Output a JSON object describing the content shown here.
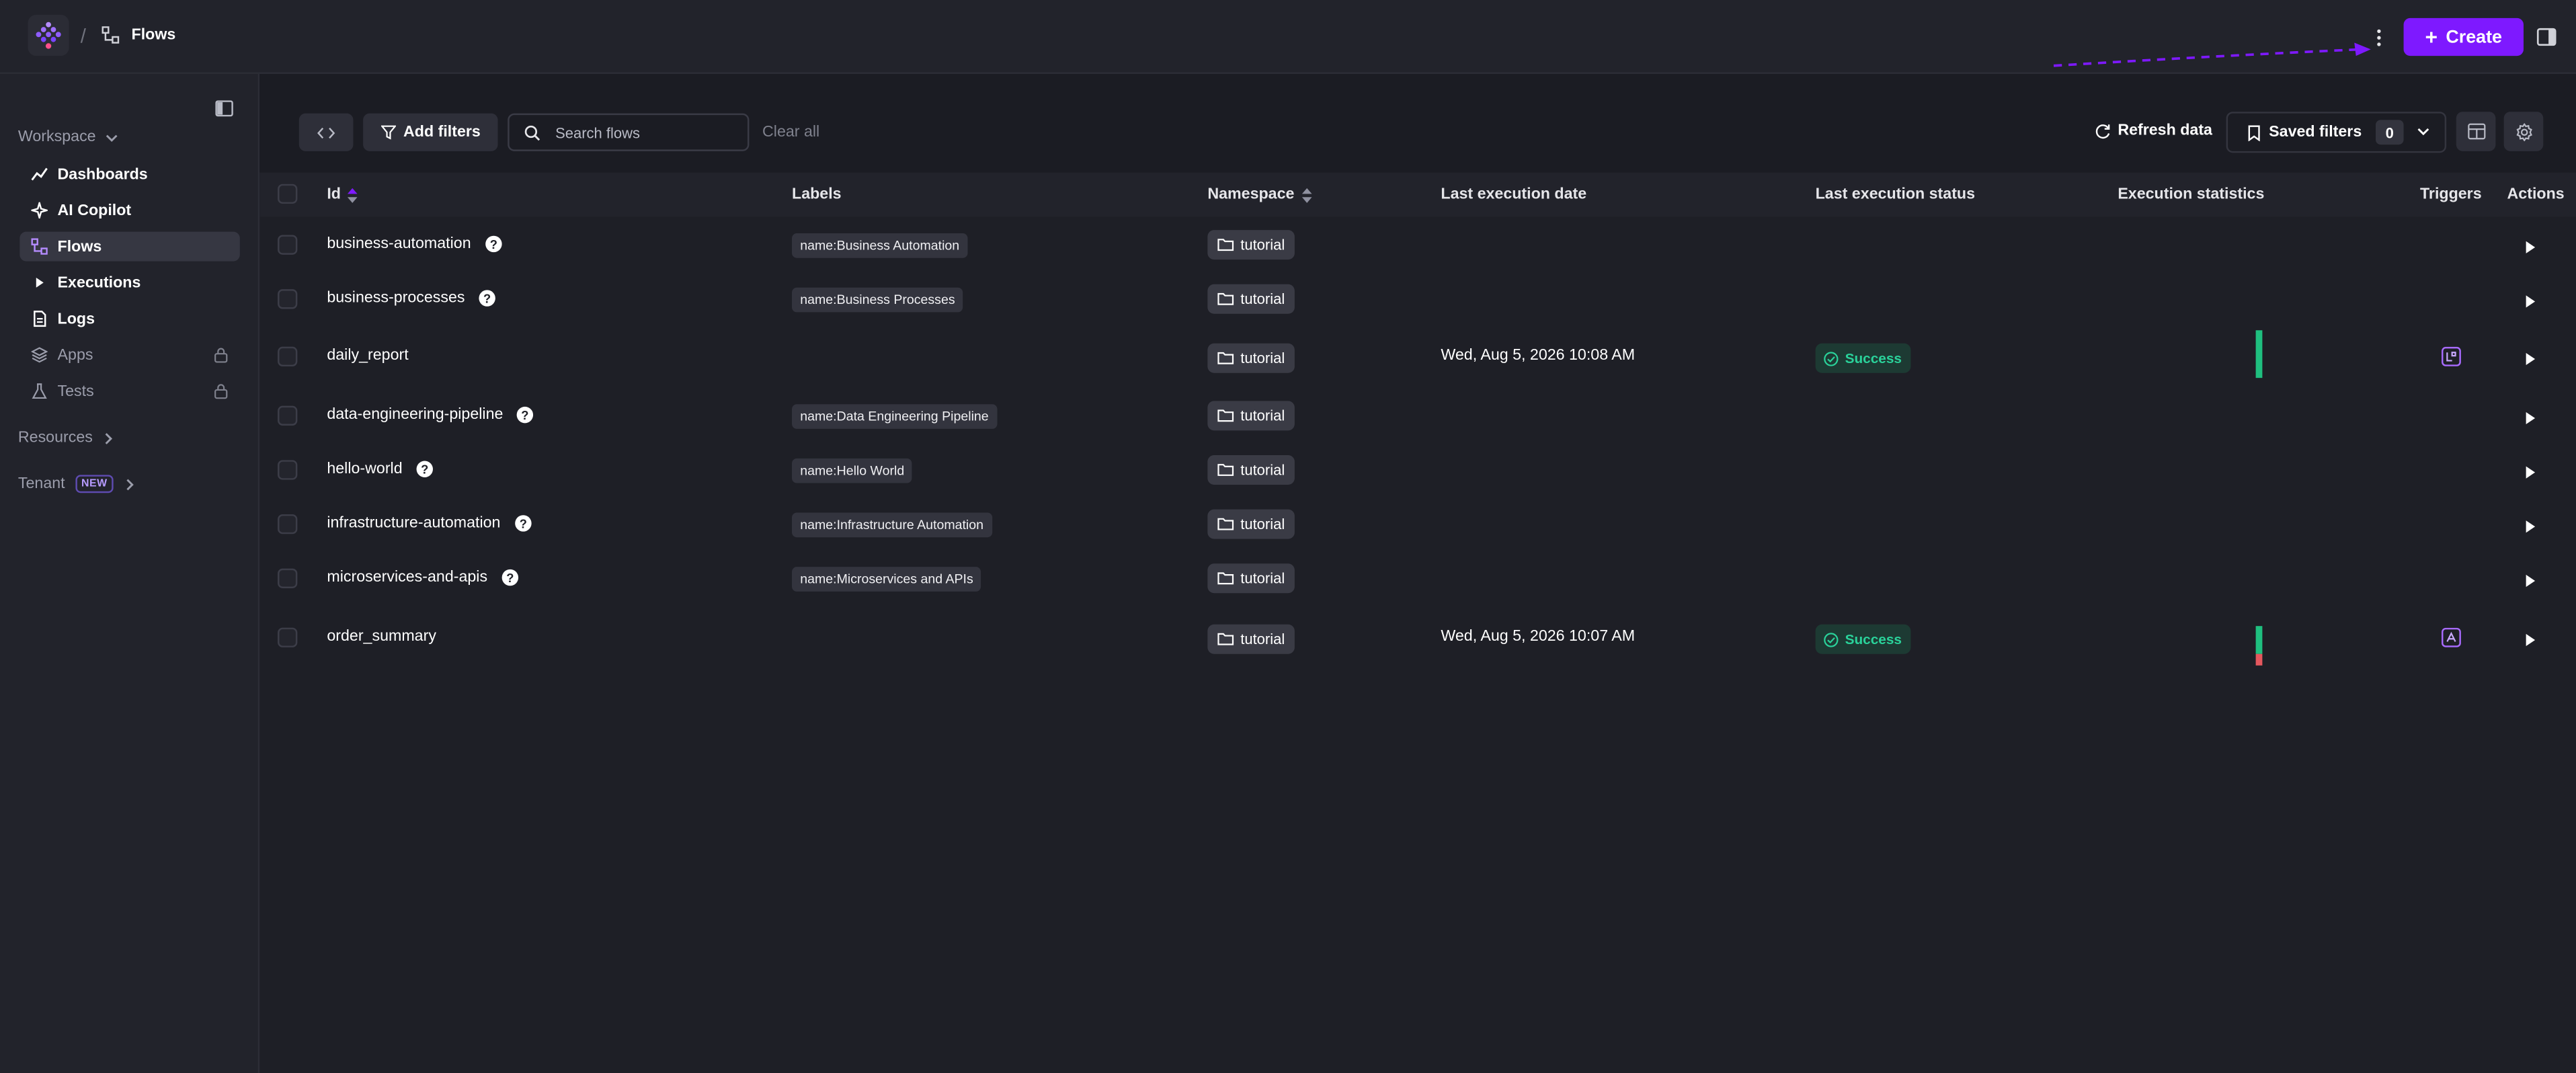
{
  "topbar": {
    "separator": "/",
    "title": "Flows",
    "create_label": "Create"
  },
  "sidebar": {
    "workspace_label": "Workspace",
    "items": [
      {
        "label": "Dashboards"
      },
      {
        "label": "AI Copilot"
      },
      {
        "label": "Flows"
      },
      {
        "label": "Executions"
      },
      {
        "label": "Logs"
      },
      {
        "label": "Apps"
      },
      {
        "label": "Tests"
      }
    ],
    "resources_label": "Resources",
    "tenant_label": "Tenant",
    "tenant_badge": "NEW"
  },
  "toolbar": {
    "add_filters_label": "Add filters",
    "search_placeholder": "Search flows",
    "clear_all_label": "Clear all",
    "refresh_label": "Refresh data",
    "saved_filters_label": "Saved filters",
    "saved_filters_count": "0"
  },
  "table": {
    "columns": {
      "id": "Id",
      "labels": "Labels",
      "namespace": "Namespace",
      "last_execution_date": "Last execution date",
      "last_execution_status": "Last execution status",
      "execution_statistics": "Execution statistics",
      "triggers": "Triggers",
      "actions": "Actions"
    },
    "rows": [
      {
        "id": "business-automation",
        "label": "name:Business Automation",
        "namespace": "tutorial",
        "date": "",
        "status": ""
      },
      {
        "id": "business-processes",
        "label": "name:Business Processes",
        "namespace": "tutorial",
        "date": "",
        "status": ""
      },
      {
        "id": "daily_report",
        "label": "",
        "namespace": "tutorial",
        "date": "Wed, Aug 5, 2026 10:08 AM",
        "status": "Success"
      },
      {
        "id": "data-engineering-pipeline",
        "label": "name:Data Engineering Pipeline",
        "namespace": "tutorial",
        "date": "",
        "status": ""
      },
      {
        "id": "hello-world",
        "label": "name:Hello World",
        "namespace": "tutorial",
        "date": "",
        "status": ""
      },
      {
        "id": "infrastructure-automation",
        "label": "name:Infrastructure Automation",
        "namespace": "tutorial",
        "date": "",
        "status": ""
      },
      {
        "id": "microservices-and-apis",
        "label": "name:Microservices and APIs",
        "namespace": "tutorial",
        "date": "",
        "status": ""
      },
      {
        "id": "order_summary",
        "label": "",
        "namespace": "tutorial",
        "date": "Wed, Aug 5, 2026 10:07 AM",
        "status": "Success"
      }
    ]
  },
  "colors": {
    "accent": "#7e19ff",
    "success": "#2ad29a",
    "failed": "#e5585e"
  }
}
